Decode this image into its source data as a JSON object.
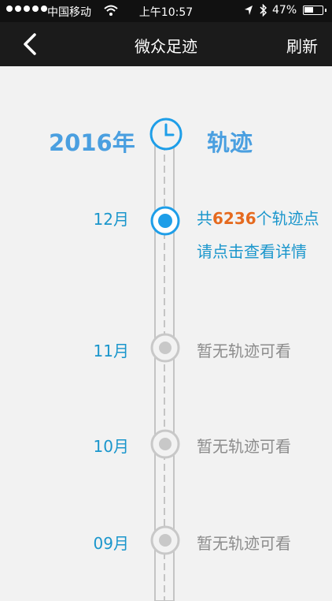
{
  "status_bar": {
    "carrier": "中国移动",
    "time": "上午10:57",
    "battery_percent": "47%",
    "battery_level": 0.47,
    "icons": [
      "signal-dots-icon",
      "wifi-icon",
      "location-arrow-icon",
      "bluetooth-icon",
      "battery-icon"
    ]
  },
  "nav": {
    "title": "微众足迹",
    "refresh_label": "刷新",
    "back_icon": "chevron-left-icon"
  },
  "timeline": {
    "year": "2016年",
    "title": "轨迹",
    "header_icon": "clock-icon",
    "colors": {
      "accent": "#1a96cc",
      "active_node": "#1e9ee8",
      "inactive_node": "#c8c8c8",
      "count": "#e56a1f",
      "empty_text": "#8c8c8c"
    },
    "entries": [
      {
        "month": "12月",
        "prefix": "共",
        "count": "6236",
        "suffix": "个轨迹点",
        "line2": "请点击查看详情",
        "active": true
      },
      {
        "month": "11月",
        "text": "暂无轨迹可看",
        "active": false
      },
      {
        "month": "10月",
        "text": "暂无轨迹可看",
        "active": false
      },
      {
        "month": "09月",
        "text": "暂无轨迹可看",
        "active": false
      }
    ]
  }
}
